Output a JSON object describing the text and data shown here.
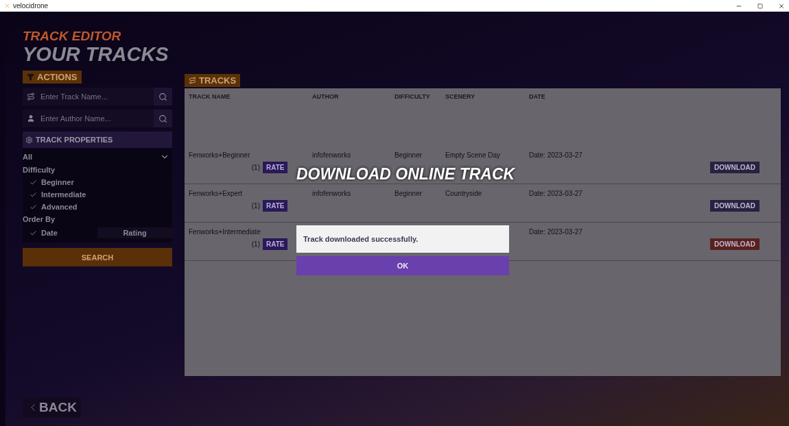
{
  "window": {
    "title": "velocidrone"
  },
  "header": {
    "subtitle": "TRACK EDITOR",
    "title": "YOUR TRACKS"
  },
  "actions": {
    "label": "ACTIONS",
    "track_search": {
      "placeholder": "Enter Track Name..."
    },
    "author_search": {
      "placeholder": "Enter Author Name..."
    },
    "properties": {
      "label": "TRACK PROPERTIES",
      "dropdown": "All",
      "difficulty_label": "Difficulty",
      "difficulty": [
        {
          "label": "Beginner",
          "checked": true
        },
        {
          "label": "Intermediate",
          "checked": true
        },
        {
          "label": "Advanced",
          "checked": true
        }
      ],
      "order_label": "Order By",
      "order": [
        {
          "label": "Date",
          "selected": true
        },
        {
          "label": "Rating",
          "selected": false
        }
      ]
    },
    "search_button": "SEARCH"
  },
  "tracks": {
    "label": "TRACKS",
    "columns": [
      "TRACK NAME",
      "AUTHOR",
      "DIFFICULTY",
      "SCENERY",
      "DATE"
    ],
    "rows": [
      {
        "name": "Fenworks+Beginner",
        "author": "infofenworks",
        "difficulty": "Beginner",
        "scenery": "Empty Scene Day",
        "date": "Date: 2023-03-27",
        "count": "(1)",
        "rate": "RATE",
        "download": "DOWNLOAD"
      },
      {
        "name": "Fenworks+Expert",
        "author": "infofenworks",
        "difficulty": "Beginner",
        "scenery": "Countryside",
        "date": "Date: 2023-03-27",
        "count": "(1)",
        "rate": "RATE",
        "download": "DOWNLOAD"
      },
      {
        "name": "Fenworks+Intermediate",
        "date": "Date: 2023-03-27",
        "count": "(1)",
        "rate": "RATE",
        "download": "DOWNLOAD"
      }
    ]
  },
  "back_button": "BACK",
  "dialog": {
    "title": "DOWNLOAD ONLINE TRACK",
    "message": "Track downloaded successfully.",
    "button": "OK"
  }
}
